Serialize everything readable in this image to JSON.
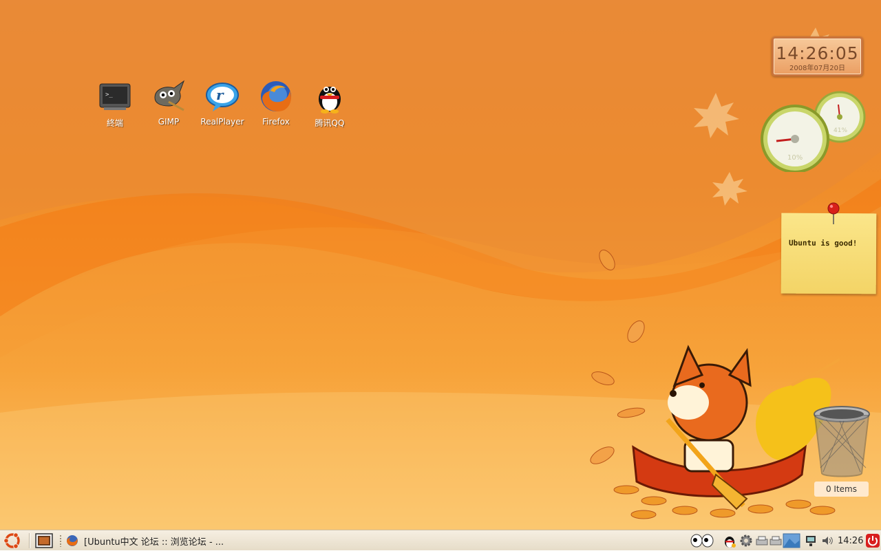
{
  "desktop_icons": [
    {
      "label": "終端",
      "icon": "terminal-icon"
    },
    {
      "label": "GIMP",
      "icon": "gimp-icon"
    },
    {
      "label": "RealPlayer",
      "icon": "realplayer-icon"
    },
    {
      "label": "Firefox",
      "icon": "firefox-icon"
    },
    {
      "label": "腾讯QQ",
      "icon": "qq-penguin-icon"
    }
  ],
  "clock_widget": {
    "time": "14:26:05",
    "date": "2008年07月20日"
  },
  "gauges": {
    "cpu_percent_label": "10%",
    "ram_percent_label": "41%"
  },
  "sticky_note": {
    "text": "Ubuntu is good!"
  },
  "trash": {
    "label": "0 Items"
  },
  "taskbar": {
    "menu_icon": "ubuntu-logo-icon",
    "window_title": "[Ubuntu中文 论坛 :: 浏览论坛 - ...",
    "clock": "14:26",
    "tray_icons": [
      "eyes-icon",
      "qq-tray-icon",
      "gear-icon",
      "printer-icon",
      "printer-icon",
      "workspace-icon",
      "network-icon",
      "volume-icon",
      "power-icon"
    ]
  },
  "colors": {
    "accent": "#f08d2a",
    "panel": "#efe6d4",
    "note": "#f6dc72"
  }
}
